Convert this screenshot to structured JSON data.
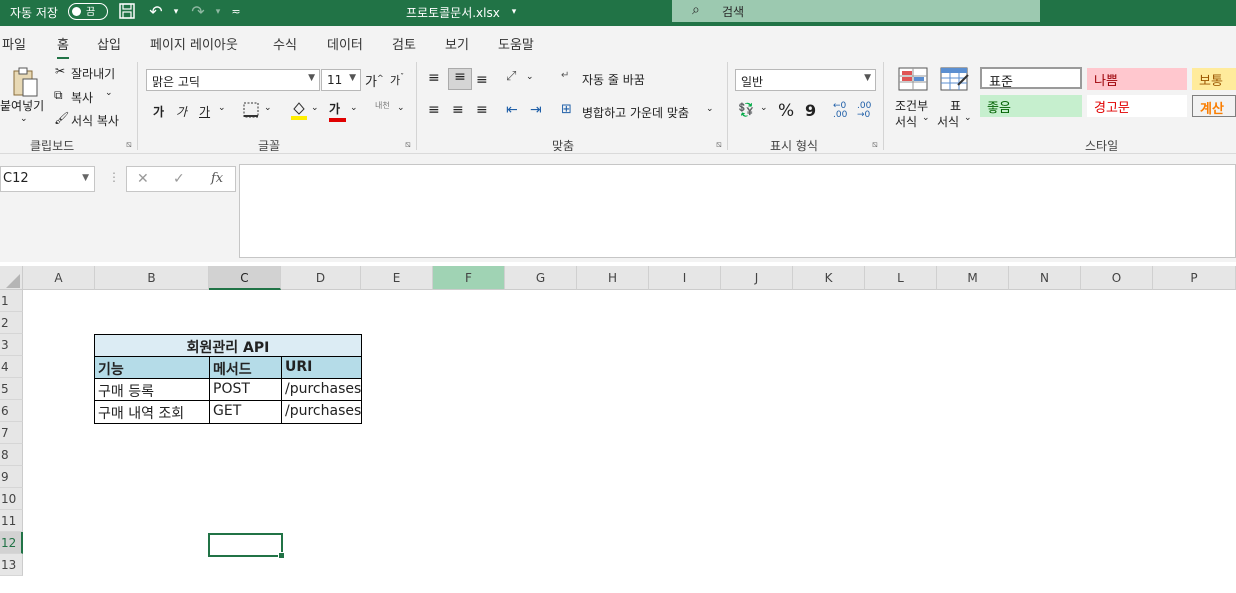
{
  "titlebar": {
    "autosave_label": "자동 저장",
    "autosave_state": "끔",
    "filename": "프로토콜문서.xlsx",
    "search_placeholder": "검색"
  },
  "tabs": [
    "파일",
    "홈",
    "삽입",
    "페이지 레이아웃",
    "수식",
    "데이터",
    "검토",
    "보기",
    "도움말"
  ],
  "active_tab": "홈",
  "ribbon": {
    "clipboard": {
      "paste": "붙여넣기",
      "cut": "잘라내기",
      "copy": "복사",
      "format_painter": "서식 복사",
      "group_label": "클립보드"
    },
    "font": {
      "font_name": "맑은 고딕",
      "font_size": "11",
      "increase_size": "가",
      "decrease_size": "가",
      "bold": "가",
      "italic": "가",
      "underline": "가",
      "font_color_sample": "가",
      "phonetic": "내천",
      "group_label": "글꼴"
    },
    "alignment": {
      "wrap_text": "자동 줄 바꿈",
      "merge_center": "병합하고 가운데 맞춤",
      "group_label": "맞춤"
    },
    "number": {
      "format": "일반",
      "percent": "%",
      "comma": "9",
      "group_label": "표시 형식"
    },
    "styles": {
      "conditional_formatting": [
        "조건부",
        "서식"
      ],
      "format_as_table": [
        "표",
        "서식"
      ],
      "normal": "표준",
      "bad": "나쁨",
      "neutral": "보통",
      "good": "좋음",
      "warning": "경고문",
      "calculation": "계산",
      "group_label": "스타일"
    }
  },
  "formula_bar": {
    "name_box": "C12",
    "fx": "fx",
    "content": ""
  },
  "columns": [
    "A",
    "B",
    "C",
    "D",
    "E",
    "F",
    "G",
    "H",
    "I",
    "J",
    "K",
    "L",
    "M",
    "N",
    "O",
    "P"
  ],
  "rows": [
    "1",
    "2",
    "3",
    "4",
    "5",
    "6",
    "7",
    "8",
    "9",
    "10",
    "11",
    "12",
    "13"
  ],
  "selected_column": "C",
  "highlighted_column": "F",
  "selected_row": "12",
  "table": {
    "title": "회원관리 API",
    "headers": [
      "기능",
      "메서드",
      "URI"
    ],
    "rows": [
      [
        "구매 등록",
        "POST",
        "/purchases"
      ],
      [
        "구매 내역 조회",
        "GET",
        "/purchases"
      ]
    ]
  },
  "colors": {
    "accent": "#217346",
    "table_title_bg": "#dcecf4",
    "table_header_bg": "#b5dce8",
    "style_bad_bg": "#ffc7ce",
    "style_good_bg": "#c6efce",
    "style_neutral_bg": "#ffeb9c"
  }
}
